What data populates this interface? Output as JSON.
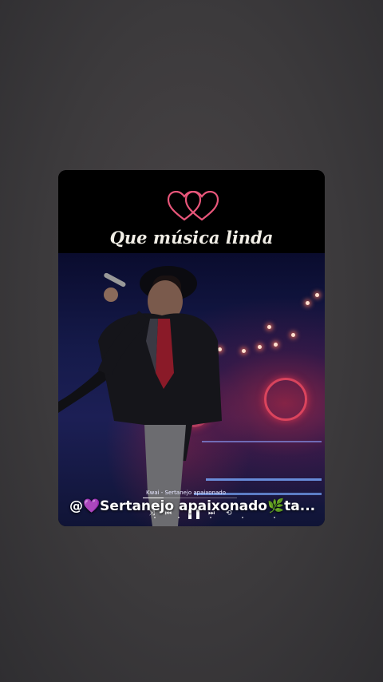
{
  "post": {
    "caption": "Que música linda",
    "username_line": "@💜Sertanejo apaixonado🌿ta..."
  },
  "player": {
    "title": "Kwai - Sertanejo apaixonado",
    "progress": 0.22,
    "shuffle_icon": "⤨",
    "prev_icon": "⏮",
    "pause_icon": "❚❚",
    "next_icon": "⏭",
    "repeat_icon": "⟲"
  },
  "icons": {
    "hearts": "double-heart-outline-icon"
  },
  "colors": {
    "heart_outline": "#e8567a",
    "caption": "#f1eee6",
    "background": "#3c3a3c"
  }
}
